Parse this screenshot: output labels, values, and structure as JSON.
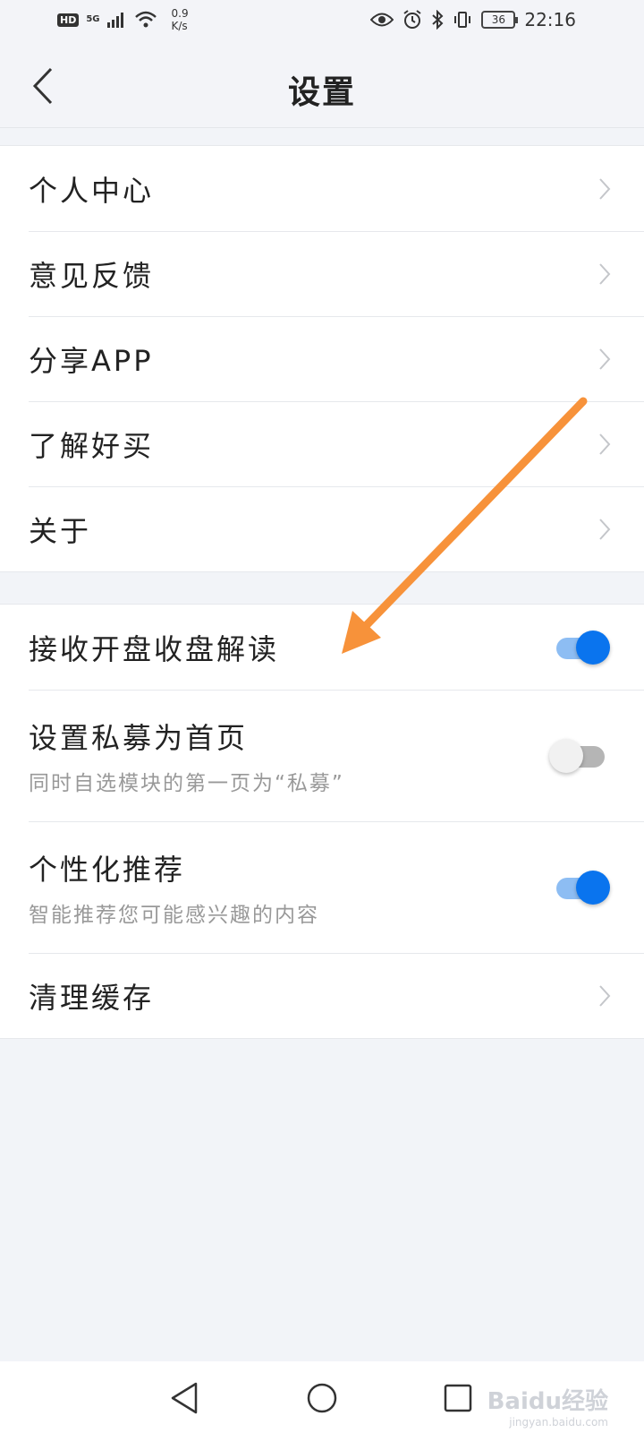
{
  "status_bar": {
    "hd": "HD",
    "network": "5G",
    "speed_value": "0.9",
    "speed_unit": "K/s",
    "battery": "36",
    "time": "22:16"
  },
  "header": {
    "title": "设置"
  },
  "group1": {
    "items": [
      {
        "label": "个人中心"
      },
      {
        "label": "意见反馈"
      },
      {
        "label": "分享APP"
      },
      {
        "label": "了解好买"
      },
      {
        "label": "关于"
      }
    ]
  },
  "group2": {
    "items": [
      {
        "label": "接收开盘收盘解读",
        "toggle": true
      },
      {
        "label": "设置私募为首页",
        "subtitle": "同时自选模块的第一页为“私募”",
        "toggle": false
      },
      {
        "label": "个性化推荐",
        "subtitle": "智能推荐您可能感兴趣的内容",
        "toggle": true
      },
      {
        "label": "清理缓存"
      }
    ]
  },
  "colors": {
    "accent": "#0a74ee",
    "annotation_arrow": "#f7923a"
  },
  "watermark": {
    "brand": "Baidu经验",
    "url": "jingyan.baidu.com"
  }
}
